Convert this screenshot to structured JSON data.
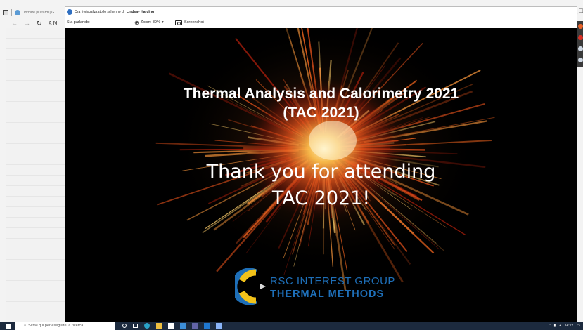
{
  "background_browser": {
    "tab_title": "Tornare più tardi | G",
    "address_fragment": "A N",
    "window_controls": "_ □"
  },
  "share_window": {
    "title_prefix": "Ora è visualizzato lo schermo di",
    "presenter": "Lindsay Harding",
    "speaking_label": "Sta parlando:",
    "zoom_label": "Zoom: 89%",
    "zoom_caret": "▾",
    "screenshot_label": "Screenshot"
  },
  "slide": {
    "title_line1": "Thermal Analysis and Calorimetry 2021",
    "title_line2": "(TAC 2021)",
    "message_line1": "Thank you for attending",
    "message_line2": "TAC 2021!",
    "logo_line1": "RSC INTEREST GROUP",
    "logo_line2": "THERMAL METHODS"
  },
  "taskbar": {
    "search_placeholder": "Scrivi qui per eseguire la ricerca",
    "time": "14:22",
    "date": ""
  },
  "colors": {
    "slide_background": "#000000",
    "logo_blue": "#1e6fb8",
    "logo_yellow": "#f2c21a",
    "taskbar": "#1c2a3e",
    "burst_core": "#ffd27a",
    "burst_outer": "#b3200c"
  }
}
